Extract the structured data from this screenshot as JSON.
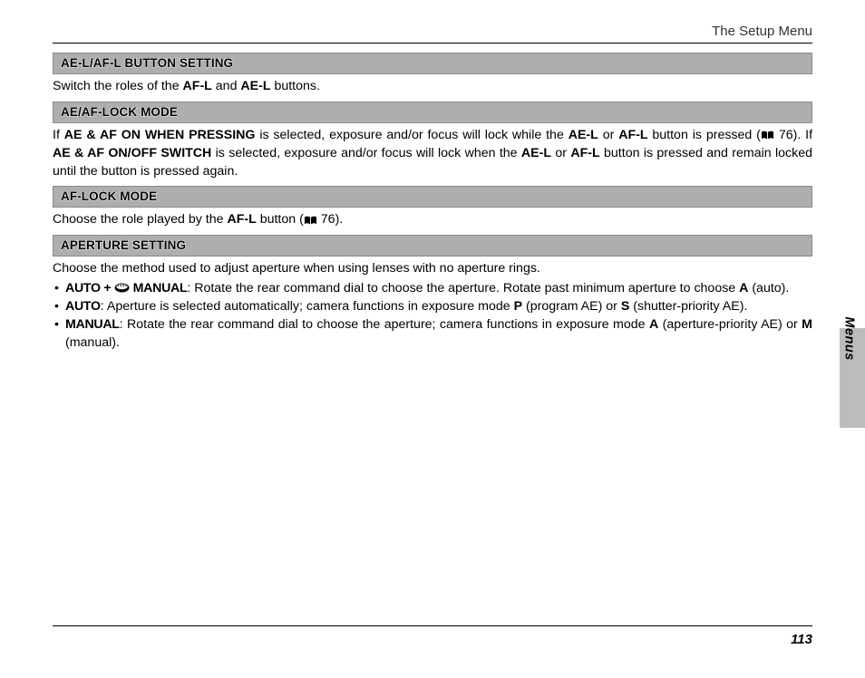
{
  "header": {
    "title": "The Setup Menu"
  },
  "side_tab": "Menus",
  "page_number": "113",
  "ref76": "76",
  "sections": {
    "s1": {
      "title": "AE-L/AF-L BUTTON SETTING",
      "p1a": "Switch the roles of the ",
      "af_l": "AF-L",
      "p1b": " and ",
      "ae_l": "AE-L",
      "p1c": " buttons."
    },
    "s2": {
      "title": "AE/AF-LOCK MODE",
      "p_if": "If ",
      "opt1": "AE & AF ON WHEN PRESSING",
      "p_sel1": " is selected, exposure and/or focus will lock while the ",
      "ae_l": "AE-L",
      "p_or": " or ",
      "af_l": "AF-L",
      "p_btn": " button is pressed (",
      "p_end1": ").  If ",
      "opt2": "AE & AF ON/OFF SWITCH",
      "p_sel2": " is selected, exposure and/or focus will lock when the ",
      "p_end2": " button is pressed and remain locked until the button is pressed again."
    },
    "s3": {
      "title": "AF-LOCK MODE",
      "p_a": "Choose the role played by the ",
      "af_l": "AF-L",
      "p_b": " button (",
      "p_c": ")."
    },
    "s4": {
      "title": "APERTURE SETTING",
      "intro": "Choose the method used to adjust aperture when using lenses with no aperture rings.",
      "b1_lead": "AUTO + ",
      "b1_lead2": " MANUAL",
      "b1_tail_a": ": Rotate the rear command dial to choose the aperture. Rotate past minimum aperture to choose ",
      "b1_A": "A",
      "b1_tail_b": " (auto).",
      "b2_lead": "AUTO",
      "b2_tail": ": Aperture is selected automatically; camera functions in exposure mode ",
      "b2_P": "P",
      "b2_mid": " (program AE) or ",
      "b2_S": "S",
      "b2_end": " (shutter-priority AE).",
      "b3_lead": "MANUAL",
      "b3_a": ": Rotate the rear command dial to choose the aperture; camera functions in exposure mode ",
      "b3_A": "A",
      "b3_b": " (aperture-priority AE) or ",
      "b3_M": "M",
      "b3_c": " (manual)."
    }
  }
}
